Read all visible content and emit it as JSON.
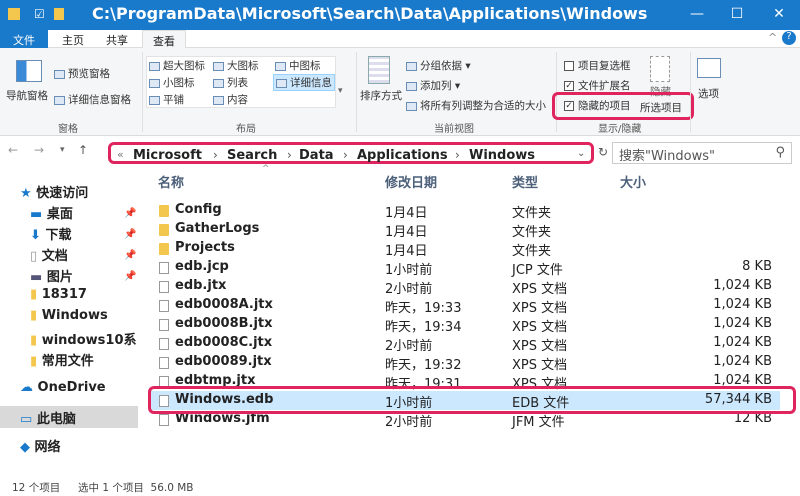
{
  "window": {
    "title": "C:\\ProgramData\\Microsoft\\Search\\Data\\Applications\\Windows",
    "minimize": "—",
    "maximize": "☐",
    "close": "✕"
  },
  "tabs": [
    "文件",
    "主页",
    "共享",
    "查看"
  ],
  "ribbon": {
    "panes": {
      "nav": "导航窗格",
      "preview": "预览窗格",
      "details": "详细信息窗格",
      "group": "窗格"
    },
    "layout": {
      "items": [
        "超大图标",
        "大图标",
        "中图标",
        "小图标",
        "列表",
        "详细信息",
        "平铺",
        "内容"
      ],
      "group": "布局"
    },
    "view": {
      "sort": "排序方式",
      "groupby": "分组依据 ▾",
      "addcol": "添加列 ▾",
      "fit": "将所有列调整为合适的大小",
      "group": "当前视图"
    },
    "show": {
      "checkboxes": "项目复选框",
      "extensions": "文件扩展名",
      "hidden": "隐藏的项目",
      "hide": "隐藏",
      "selected": "所选项目",
      "group": "显示/隐藏"
    },
    "options": "选项"
  },
  "address": {
    "crumbs": [
      "Microsoft",
      "Search",
      "Data",
      "Applications",
      "Windows"
    ],
    "search_placeholder": "搜索\"Windows\""
  },
  "sidebar": {
    "items": [
      {
        "label": "快速访问"
      },
      {
        "label": "桌面"
      },
      {
        "label": "下载"
      },
      {
        "label": "文档"
      },
      {
        "label": "图片"
      },
      {
        "label": "18317"
      },
      {
        "label": "Windows"
      },
      {
        "label": "windows10系"
      },
      {
        "label": "常用文件"
      },
      {
        "label": "OneDrive"
      },
      {
        "label": "此电脑"
      },
      {
        "label": "网络"
      }
    ]
  },
  "columns": {
    "name": "名称",
    "date": "修改日期",
    "type": "类型",
    "size": "大小"
  },
  "files": [
    {
      "name": "Config",
      "date": "1月4日",
      "type": "文件夹",
      "size": "",
      "kind": "folder"
    },
    {
      "name": "GatherLogs",
      "date": "1月4日",
      "type": "文件夹",
      "size": "",
      "kind": "folder"
    },
    {
      "name": "Projects",
      "date": "1月4日",
      "type": "文件夹",
      "size": "",
      "kind": "folder"
    },
    {
      "name": "edb.jcp",
      "date": "1小时前",
      "type": "JCP 文件",
      "size": "8 KB",
      "kind": "file"
    },
    {
      "name": "edb.jtx",
      "date": "2小时前",
      "type": "XPS 文档",
      "size": "1,024 KB",
      "kind": "file"
    },
    {
      "name": "edb0008A.jtx",
      "date": "昨天，19:33",
      "type": "XPS 文档",
      "size": "1,024 KB",
      "kind": "file"
    },
    {
      "name": "edb0008B.jtx",
      "date": "昨天，19:34",
      "type": "XPS 文档",
      "size": "1,024 KB",
      "kind": "file"
    },
    {
      "name": "edb0008C.jtx",
      "date": "2小时前",
      "type": "XPS 文档",
      "size": "1,024 KB",
      "kind": "file"
    },
    {
      "name": "edb00089.jtx",
      "date": "昨天，19:32",
      "type": "XPS 文档",
      "size": "1,024 KB",
      "kind": "file"
    },
    {
      "name": "edbtmp.jtx",
      "date": "昨天，19:31",
      "type": "XPS 文档",
      "size": "1,024 KB",
      "kind": "file"
    },
    {
      "name": "Windows.edb",
      "date": "1小时前",
      "type": "EDB 文件",
      "size": "57,344 KB",
      "kind": "file"
    },
    {
      "name": "Windows.jfm",
      "date": "2小时前",
      "type": "JFM 文件",
      "size": "12 KB",
      "kind": "file"
    }
  ],
  "status": {
    "count": "12 个项目",
    "selected": "选中 1 个项目  56.0 MB"
  },
  "colors": {
    "titlebar": "#1979ca",
    "highlight": "#e0245e",
    "selection": "#cce8ff"
  }
}
